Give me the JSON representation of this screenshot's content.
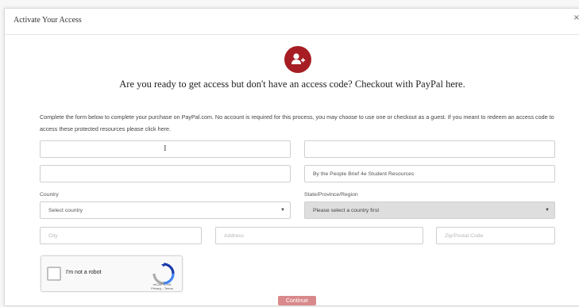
{
  "modal": {
    "title": "Activate Your Access",
    "close_label": "×"
  },
  "headline": "Are you ready to get access but don't have an access code? Checkout with PayPal here.",
  "intro_text": "Complete the form below to complete your purchase on PayPal.com. No account is required for this process, you may choose to use one or checkout as a guest. If you meant to redeem an access code to access these protected resources please click here.",
  "form": {
    "first_name_value": "",
    "last_name_value": "",
    "email_value": "",
    "product_value": "By the People Brief 4e Student Resources",
    "country_label": "Country",
    "country_value": "Select country",
    "state_label": "State/Province/Region",
    "state_value": "Please select a country first",
    "city_placeholder": "City",
    "address_placeholder": "Address",
    "zip_placeholder": "Zip/Postal Code",
    "cursor_glyph": "I"
  },
  "recaptcha": {
    "label": "I'm not a robot",
    "brand": "reCAPTCHA",
    "links": "Privacy - Terms"
  },
  "continue_label": "Continue",
  "colors": {
    "accent": "#a61e23",
    "continue_bg": "#d9898b",
    "disabled_bg": "#dedede"
  }
}
